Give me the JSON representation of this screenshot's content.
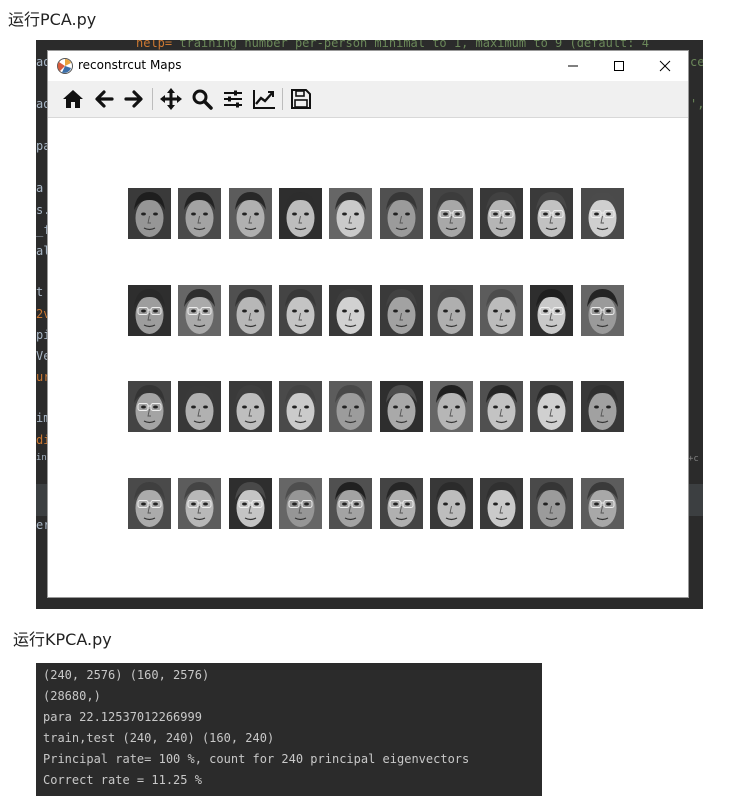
{
  "captions": {
    "pca": "运行PCA.py",
    "kpca": "运行KPCA.py"
  },
  "ide": {
    "top_line_help": "help=",
    "top_line_rest": " training number per-person minimal to 1, maximum to 9 (default: 4",
    "fragments": [
      "ad",
      "ad",
      "pa",
      " a",
      "s.",
      "_f",
      "al",
      "t",
      "2v",
      "pi",
      "Ve",
      "ur",
      "im",
      "di",
      "in",
      "er"
    ],
    "right_fragments": [
      "ce",
      "',",
      "+c"
    ]
  },
  "window": {
    "title": "reconstrcut Maps",
    "controls": {
      "minimize": "minimize-icon",
      "maximize": "maximize-icon",
      "close": "close-icon"
    }
  },
  "toolbar": [
    {
      "name": "home",
      "icon": "home-icon"
    },
    {
      "name": "back",
      "icon": "arrow-left-icon"
    },
    {
      "name": "forward",
      "icon": "arrow-right-icon"
    },
    {
      "name": "pan",
      "icon": "move-icon"
    },
    {
      "name": "zoom",
      "icon": "magnifier-icon"
    },
    {
      "name": "subplots",
      "icon": "sliders-icon"
    },
    {
      "name": "edit-axes",
      "icon": "line-chart-icon"
    },
    {
      "name": "save",
      "icon": "floppy-disk-icon"
    }
  ],
  "figure": {
    "rows": 4,
    "cols": 10
  },
  "terminal": {
    "lines": [
      "(240, 2576) (160, 2576)",
      "(28680,)",
      "para 22.12537012266999",
      "train,test (240, 240) (160, 240)",
      "Principal rate= 100 %, count for 240 principal eigenvectors",
      "Correct rate = 11.25 %"
    ]
  }
}
